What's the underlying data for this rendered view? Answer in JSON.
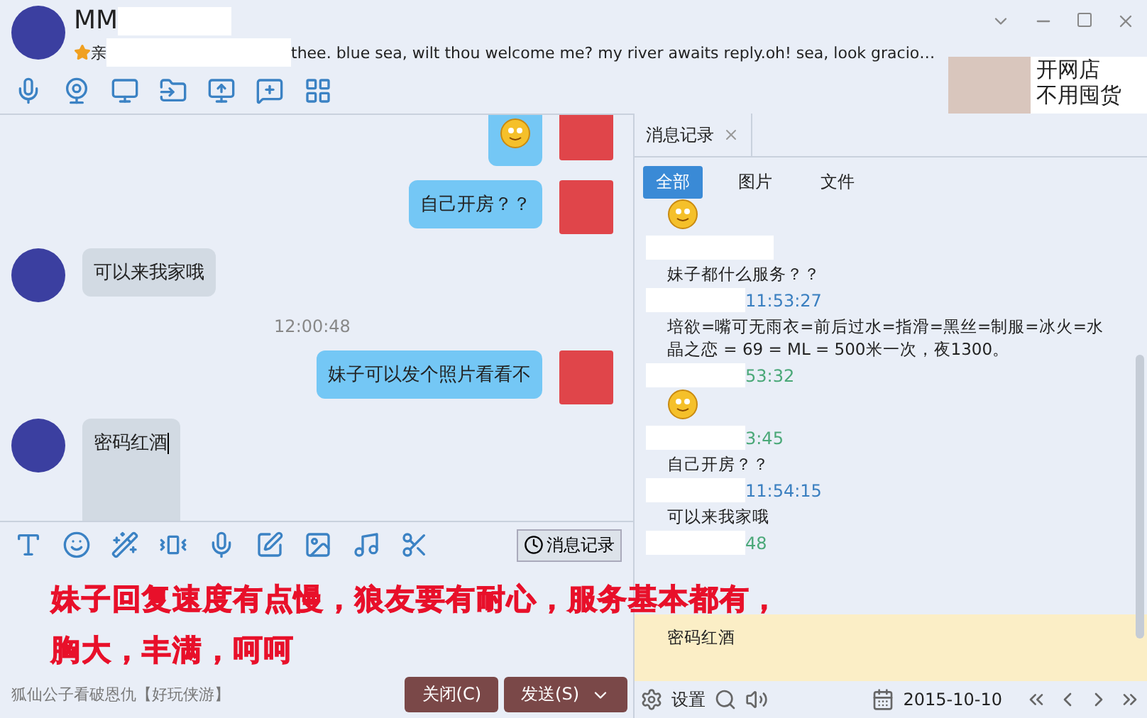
{
  "header": {
    "title": "MM",
    "status_prefix": "亲",
    "status": "thee. blue sea, wilt thou welcome me? my river awaits reply.oh! sea, look gracio…",
    "ad": [
      "开网店",
      "不用囤货"
    ]
  },
  "chat": [
    {
      "kind": "emoji",
      "outgoing": true
    },
    {
      "kind": "text",
      "outgoing": true,
      "text": "自己开房？？"
    },
    {
      "kind": "text",
      "outgoing": false,
      "text": "可以来我家哦"
    },
    {
      "kind": "time",
      "text": "12:00:48"
    },
    {
      "kind": "text",
      "outgoing": true,
      "text": "妹子可以发个照片看看不"
    },
    {
      "kind": "draft",
      "outgoing": false,
      "text": "密码红酒"
    }
  ],
  "input_toolbar": {
    "history_button": "消息记录"
  },
  "caption": [
    "妹子回复速度有点慢，狼友要有耐心，服务基本都有，",
    "胸大，丰满，呵呵"
  ],
  "footer": {
    "ad_link": "狐仙公子看破恩仇【好玩侠游】",
    "buttons": [
      "关闭(C)",
      "发送(S)"
    ]
  },
  "history": {
    "tab": "消息记录",
    "filters": [
      {
        "label": "全部",
        "selected": true
      },
      {
        "label": "图片",
        "selected": false
      },
      {
        "label": "文件",
        "selected": false
      }
    ],
    "entries": [
      {
        "kind": "emoji"
      },
      {
        "kind": "header"
      },
      {
        "kind": "text",
        "text": "妹子都什么服务？？",
        "highlight": false
      },
      {
        "kind": "header",
        "time": "11:53:27",
        "color": "#3a7fc0"
      },
      {
        "kind": "text",
        "text": "培欲=嘴可无雨衣=前后过水=指滑=黑丝=制服=冰火=水晶之恋 = 69 = ML = 500米一次，夜1300。",
        "highlight": false
      },
      {
        "kind": "header",
        "time": "53:32",
        "color": "#4aa878"
      },
      {
        "kind": "emoji"
      },
      {
        "kind": "header",
        "time": "3:45",
        "color": "#4aa878"
      },
      {
        "kind": "text",
        "text": "自己开房？？",
        "highlight": false
      },
      {
        "kind": "header",
        "time": "11:54:15",
        "color": "#3a7fc0"
      },
      {
        "kind": "text",
        "text": "可以来我家哦",
        "highlight": false
      },
      {
        "kind": "header",
        "time": "48",
        "color": "#4aa878"
      },
      {
        "kind": "spacer"
      },
      {
        "kind": "text",
        "text": "密码红酒",
        "highlight": true
      }
    ],
    "settings": "设置",
    "date": "2015-10-10"
  }
}
